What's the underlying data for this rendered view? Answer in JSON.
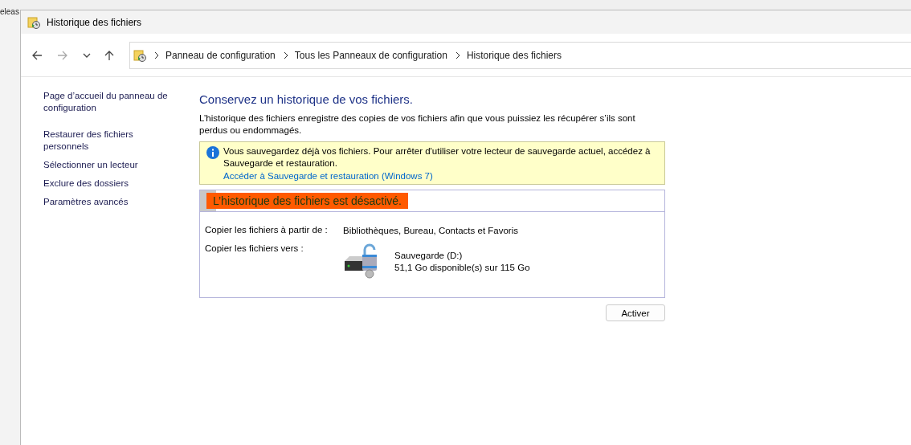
{
  "background": {
    "text": "eleas"
  },
  "window": {
    "title": "Historique des fichiers"
  },
  "breadcrumb": [
    "Panneau de configuration",
    "Tous les Panneaux de configuration",
    "Historique des fichiers"
  ],
  "sidebar": {
    "items": [
      "Page d’accueil du panneau de configuration",
      "Restaurer des fichiers personnels",
      "Sélectionner un lecteur",
      "Exclure des dossiers",
      "Paramètres avancés"
    ]
  },
  "main": {
    "heading": "Conservez un historique de vos fichiers.",
    "description": "L’historique des fichiers enregistre des copies de vos fichiers afin que vous puissiez les récupérer s’ils sont perdus ou endommagés.",
    "info": {
      "text": "Vous sauvegardez déjà vos fichiers. Pour arrêter d'utiliser votre lecteur de sauvegarde actuel, accédez à Sauvegarde et restauration.",
      "link": "Accéder à Sauvegarde et restauration (Windows 7)"
    },
    "status": {
      "title": "L’historique des fichiers est désactivé.",
      "highlighted": true,
      "copy_from_label": "Copier les fichiers à partir de :",
      "copy_from_value": "Bibliothèques, Bureau, Contacts et Favoris",
      "copy_to_label": "Copier les fichiers vers :",
      "drive_name": "Sauvegarde (D:)",
      "drive_space": "51,1 Go disponible(s) sur 115 Go"
    },
    "button": "Activer"
  }
}
